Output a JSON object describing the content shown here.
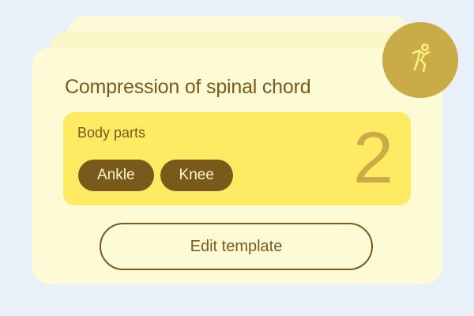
{
  "card": {
    "title": "Compression of spinal chord",
    "body_parts": {
      "label": "Body parts",
      "tags": [
        "Ankle",
        "Knee"
      ],
      "count": "2"
    },
    "edit_button_label": "Edit template"
  },
  "avatar": {
    "icon": "person-exercise-icon"
  },
  "colors": {
    "background": "#e8f1fa",
    "card": "#fdfbd6",
    "panel": "#ffea63",
    "accent": "#c9ac48",
    "brown": "#7a5a1a"
  }
}
